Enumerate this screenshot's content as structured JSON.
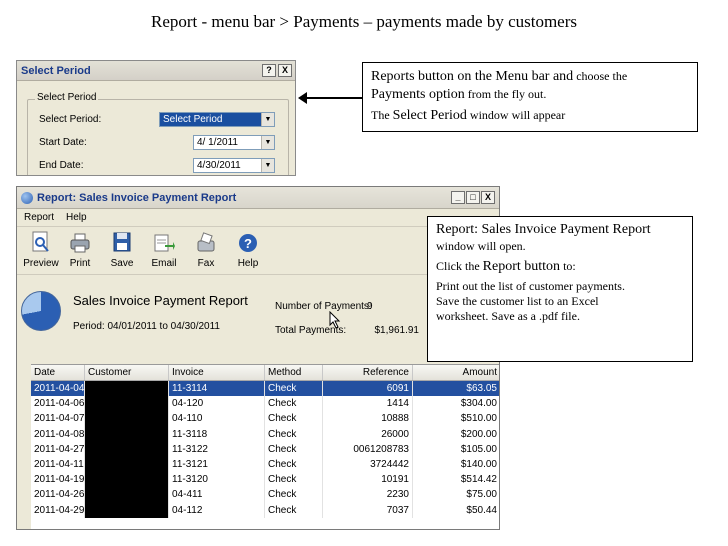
{
  "slide_title": "Report - menu bar >  Payments – payments made by customers",
  "select_period": {
    "title": "Select Period",
    "help_btn": "?",
    "close_btn": "X",
    "group_label": "Select Period",
    "select_period_label": "Select Period:",
    "select_period_value": "Select Period",
    "start_date_label": "Start Date:",
    "start_date_value": "4/ 1/2011",
    "end_date_label": "End Date:",
    "end_date_value": "4/30/2011"
  },
  "callout_1": {
    "line1_big": "Reports button on the Menu bar and",
    "line1_small": " choose the",
    "line2_big": "Payments option",
    "line2_small": " from the fly out.",
    "line3_a": "The ",
    "line3_big": "Select Period",
    "line3_small": " window will appear"
  },
  "report_window": {
    "title": "Report: Sales Invoice Payment Report",
    "min_btn": "_",
    "max_btn": "□",
    "close_btn": "X",
    "menu": [
      "Report",
      "Help"
    ],
    "toolbar": [
      "Preview",
      "Print",
      "Save",
      "Email",
      "Fax",
      "Help"
    ],
    "report_name": "Sales Invoice Payment Report",
    "period": "Period: 04/01/2011 to 04/30/2011",
    "num_payments_label": "Number of Payments:",
    "num_payments_value": "9",
    "total_payments_label": "Total Payments:",
    "total_payments_value": "$1,961.91",
    "columns": [
      "Date",
      "Customer",
      "Invoice",
      "Method",
      "Reference",
      "Amount"
    ],
    "rows": [
      {
        "date": "2011-04-04",
        "invoice": "11-3114",
        "method": "Check",
        "reference": "6091",
        "amount": "$63.05"
      },
      {
        "date": "2011-04-06",
        "invoice": "04-120",
        "method": "Check",
        "reference": "1414",
        "amount": "$304.00"
      },
      {
        "date": "2011-04-07",
        "invoice": "04-110",
        "method": "Check",
        "reference": "10888",
        "amount": "$510.00"
      },
      {
        "date": "2011-04-08",
        "invoice": "11-3118",
        "method": "Check",
        "reference": "26000",
        "amount": "$200.00"
      },
      {
        "date": "2011-04-27",
        "invoice": "11-3122",
        "method": "Check",
        "reference": "0061208783",
        "amount": "$105.00"
      },
      {
        "date": "2011-04-11",
        "invoice": "11-3121",
        "method": "Check",
        "reference": "3724442",
        "amount": "$140.00"
      },
      {
        "date": "2011-04-19",
        "invoice": "11-3120",
        "method": "Check",
        "reference": "10191",
        "amount": "$514.42"
      },
      {
        "date": "2011-04-26",
        "invoice": "04-411",
        "method": "Check",
        "reference": "2230",
        "amount": "$75.00"
      },
      {
        "date": "2011-04-29",
        "invoice": "04-112",
        "method": "Check",
        "reference": "7037",
        "amount": "$50.44"
      }
    ],
    "selected_row_color": "#2350a0"
  },
  "callout_2": {
    "line1": "Report: Sales Invoice Payment Report",
    "line2": "window will open.",
    "line3_a": "Click the ",
    "line3_big": "Report button",
    "line3_b": " to:",
    "line4": "Print out the list of customer payments.",
    "line5": "Save the customer list to an Excel",
    "line6": "worksheet. Save as a .pdf file."
  }
}
